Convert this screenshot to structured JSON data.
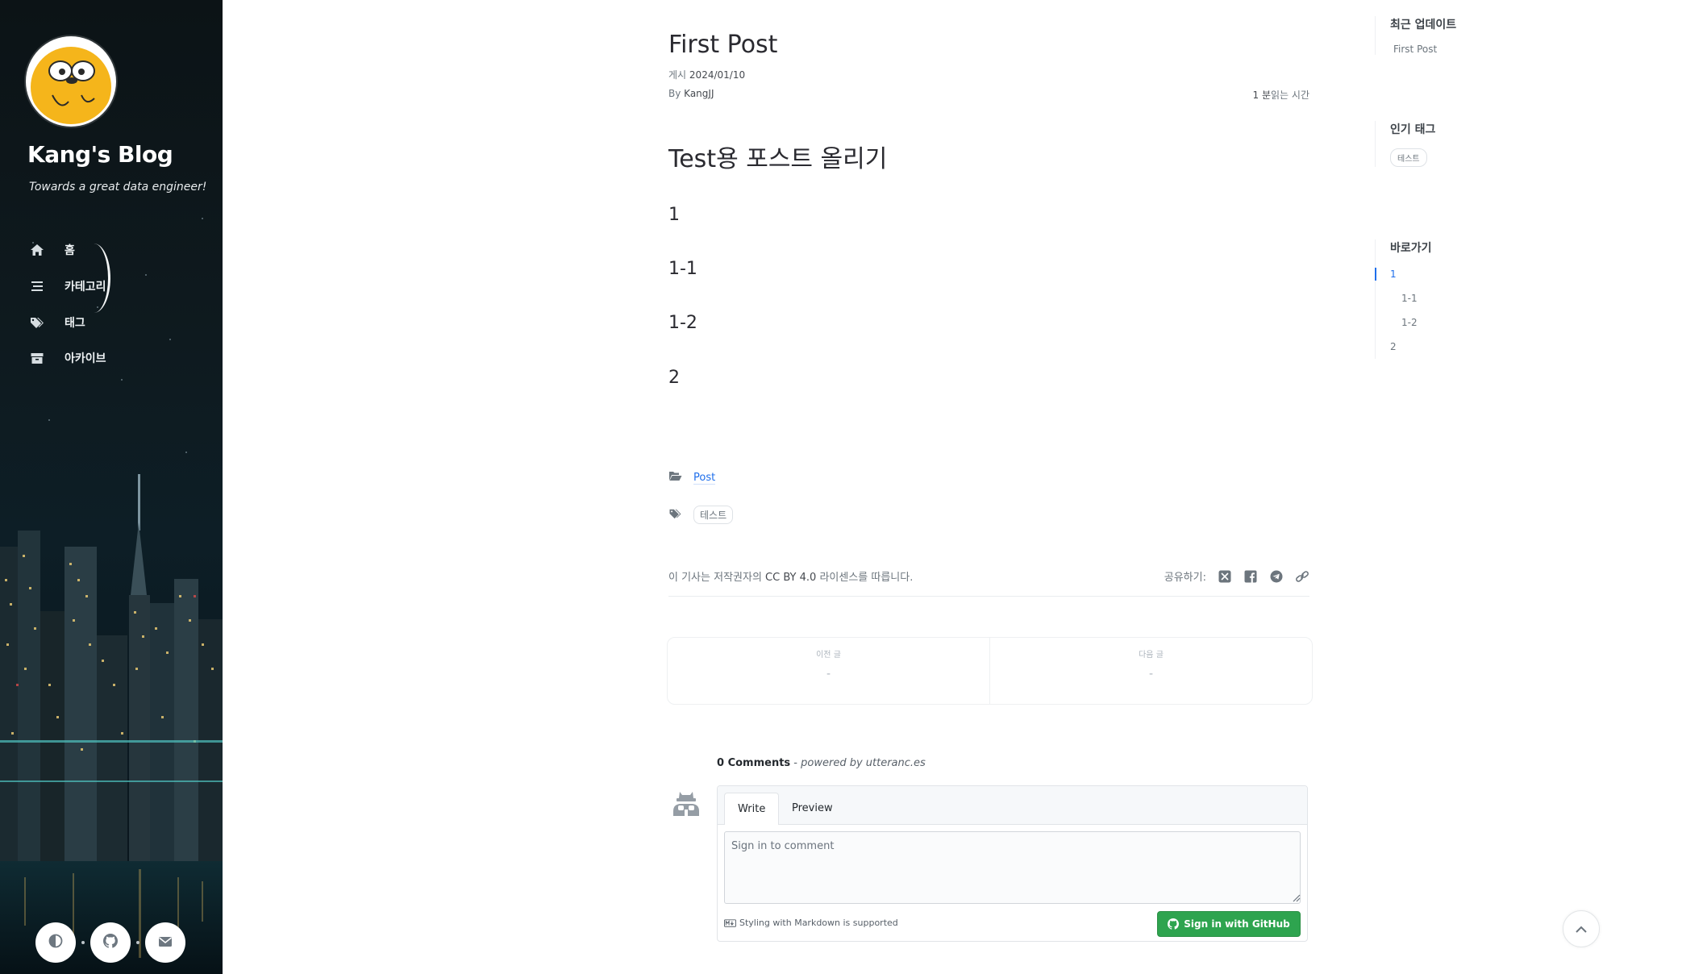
{
  "sidebar": {
    "site_title": "Kang's Blog",
    "site_subtitle": "Towards a great data engineer!",
    "nav": [
      {
        "label": "홈",
        "icon": "home-icon"
      },
      {
        "label": "카테고리",
        "icon": "stream-icon"
      },
      {
        "label": "태그",
        "icon": "tags-icon"
      },
      {
        "label": "아카이브",
        "icon": "archive-icon"
      }
    ],
    "buttons": [
      {
        "icon": "theme-toggle-icon"
      },
      {
        "icon": "github-icon"
      },
      {
        "icon": "envelope-icon"
      }
    ]
  },
  "post": {
    "title": "First Post",
    "posted_label": "게시",
    "posted_date": "2024/01/10",
    "by_label": "By",
    "author": "KangJJ",
    "read_time_value": "1 분",
    "read_time_label": "읽는 시간",
    "headings": [
      {
        "text": "Test용 포스트 올리기"
      },
      {
        "text": "1"
      },
      {
        "text": "1-1"
      },
      {
        "text": "1-2"
      },
      {
        "text": "2"
      }
    ],
    "category": "Post",
    "tag": "테스트",
    "license_prefix": "이 기사는 저작권자의",
    "license_name": "CC BY 4.0",
    "license_suffix": "라이센스를 따릅니다.",
    "share_label": "공유하기:",
    "share_icons": [
      "x-twitter-icon",
      "facebook-icon",
      "telegram-icon",
      "link-icon"
    ]
  },
  "pager": {
    "prev_label": "이전 글",
    "prev_value": "-",
    "next_label": "다음 글",
    "next_value": "-"
  },
  "comments": {
    "count": "0 Comments",
    "separator": " - ",
    "powered": "powered by utteranc.es",
    "tab_write": "Write",
    "tab_preview": "Preview",
    "placeholder": "Sign in to comment",
    "markdown_note": "Styling with Markdown is supported",
    "signin_button": "Sign in with GitHub"
  },
  "panel": {
    "recent_heading": "최근 업데이트",
    "recent_items": [
      "First Post"
    ],
    "tags_heading": "인기 태그",
    "tags": [
      "테스트"
    ],
    "toc_heading": "바로가기",
    "toc": [
      {
        "label": "1",
        "level": 1,
        "active": true
      },
      {
        "label": "1-1",
        "level": 2,
        "active": false
      },
      {
        "label": "1-2",
        "level": 2,
        "active": false
      },
      {
        "label": "2",
        "level": 1,
        "active": false
      }
    ]
  },
  "colors": {
    "accent": "#1f6feb",
    "github_button": "#2ea44f",
    "sidebar_bg": "#0e1a1f"
  }
}
